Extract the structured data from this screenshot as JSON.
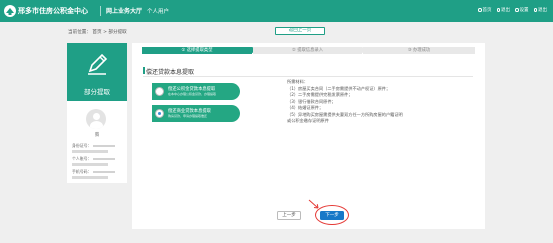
{
  "topbar": {
    "brand": "邢多市住房公积金中心",
    "nav_hall": "网上业务大厅",
    "nav_user": "个人用户",
    "actions": [
      {
        "label": "首页",
        "icon": "home-icon"
      },
      {
        "label": "退出",
        "icon": "logout-icon"
      },
      {
        "label": "设置",
        "icon": "gear-icon"
      },
      {
        "label": "退出",
        "icon": "power-icon"
      }
    ]
  },
  "breadcrumb": "当前位置：  首页 > 部分提取",
  "back_button": "返回上一页",
  "left_panel": {
    "title": "部分提取",
    "user_name": "腾",
    "id_label": "身份证号：",
    "account_label": "个人账号：",
    "phone_label": "手机号码："
  },
  "steps": [
    "① 选择提取类型",
    "② 提取信息录入",
    "③ 办理成功"
  ],
  "section_title": "偿还贷款本息提取",
  "options": [
    {
      "title": "偿还公积金贷款本息提取",
      "desc": "在本中心办理公积金贷款，办理提取"
    },
    {
      "title": "偿还商业贷款本息提取",
      "desc": "购房贷款，申请办理提取偿还"
    }
  ],
  "materials": {
    "heading": "所需材料：",
    "items": [
      "（1）房屋买卖合同（二手房需提供不动产权证）原件；",
      "（2）二手房需提供完税发票原件；",
      "（3）银行借款合同原件；",
      "（4）结婚证原件；",
      "（5）异地购买房屋需提供夫妻双方任一方所购房屋的户籍证明",
      "或公积金缴存证明原件"
    ]
  },
  "buttons": {
    "prev": "上一步",
    "next": "下一步"
  },
  "colors": {
    "brand": "#1f9f86",
    "primary_button": "#1778c8",
    "highlight": "#e53935"
  }
}
